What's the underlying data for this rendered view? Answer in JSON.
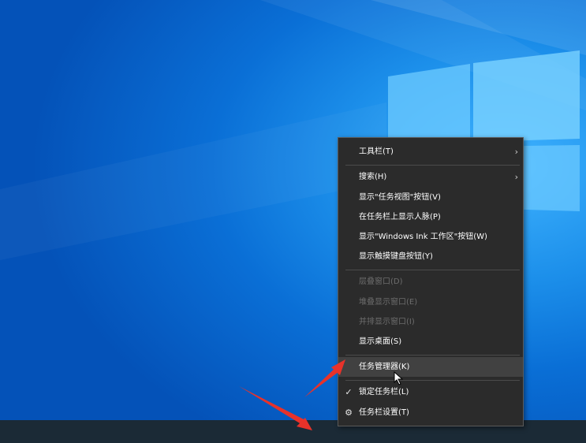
{
  "menu": {
    "items": [
      {
        "label": "工具栏(T)",
        "submenu": true
      },
      {
        "label": "搜索(H)",
        "submenu": true
      },
      {
        "label": "显示\"任务视图\"按钮(V)"
      },
      {
        "label": "在任务栏上显示人脉(P)"
      },
      {
        "label": "显示\"Windows Ink 工作区\"按钮(W)"
      },
      {
        "label": "显示触摸键盘按钮(Y)"
      },
      {
        "label": "层叠窗口(D)",
        "disabled": true
      },
      {
        "label": "堆叠显示窗口(E)",
        "disabled": true
      },
      {
        "label": "并排显示窗口(I)",
        "disabled": true
      },
      {
        "label": "显示桌面(S)"
      },
      {
        "label": "任务管理器(K)",
        "highlighted": true
      },
      {
        "label": "锁定任务栏(L)",
        "checked": true
      },
      {
        "label": "任务栏设置(T)",
        "icon": "gear-icon"
      }
    ]
  },
  "icons": {
    "submenu": "chevron-right-icon",
    "check": "checkmark-icon",
    "settings": "gear-icon",
    "cursor": "mouse-pointer-icon",
    "annotation": "red-arrow-icon"
  },
  "colors": {
    "menu_bg": "#2b2b2b",
    "menu_text": "#ffffff",
    "disabled_text": "#6d6d6d",
    "hover_bg": "#414141",
    "desktop_blue": "#0a6fd6",
    "taskbar": "#1b2a36",
    "annotation_red": "#e8322a"
  }
}
